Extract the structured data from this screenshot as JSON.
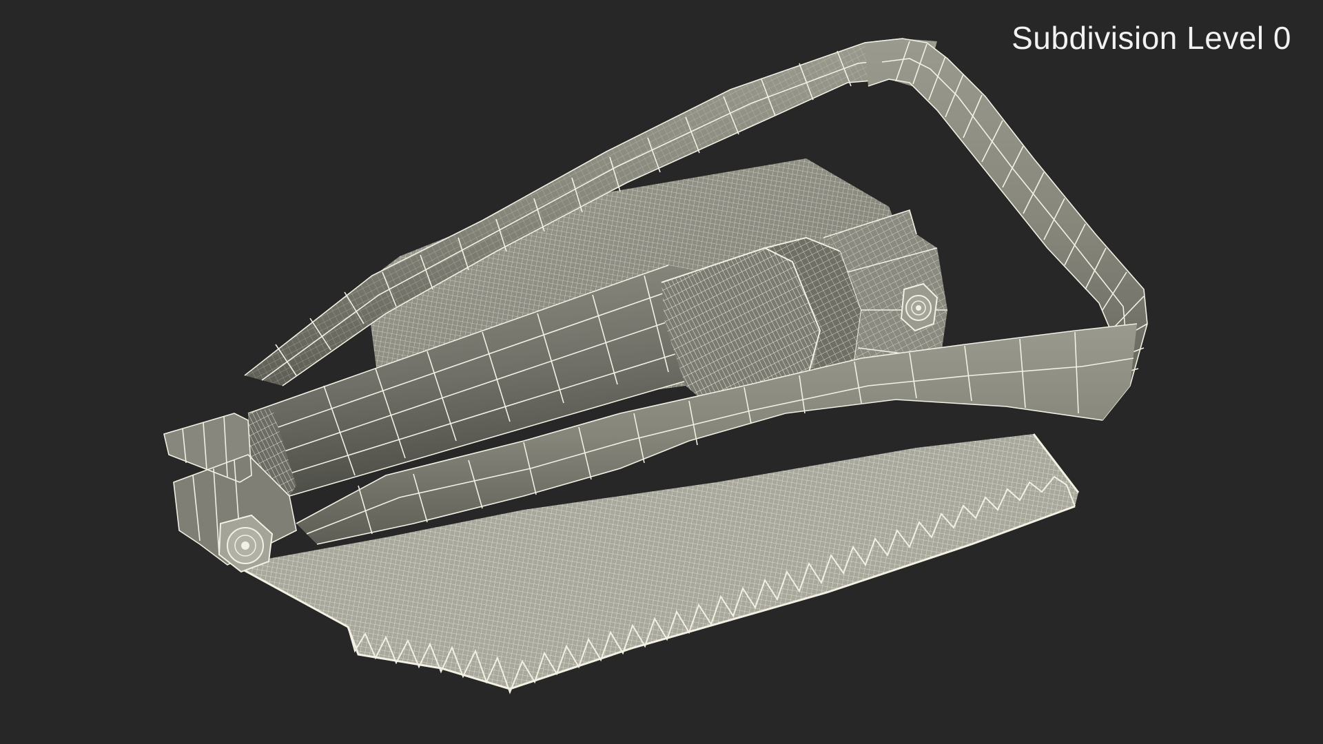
{
  "viewport": {
    "subdivision_label": "Subdivision Level 0"
  },
  "render": {
    "background_color": "#272727",
    "surface_color": "#8f8f84",
    "surface_dark": "#5f5f57",
    "wire_color": "#f3f1e4"
  }
}
